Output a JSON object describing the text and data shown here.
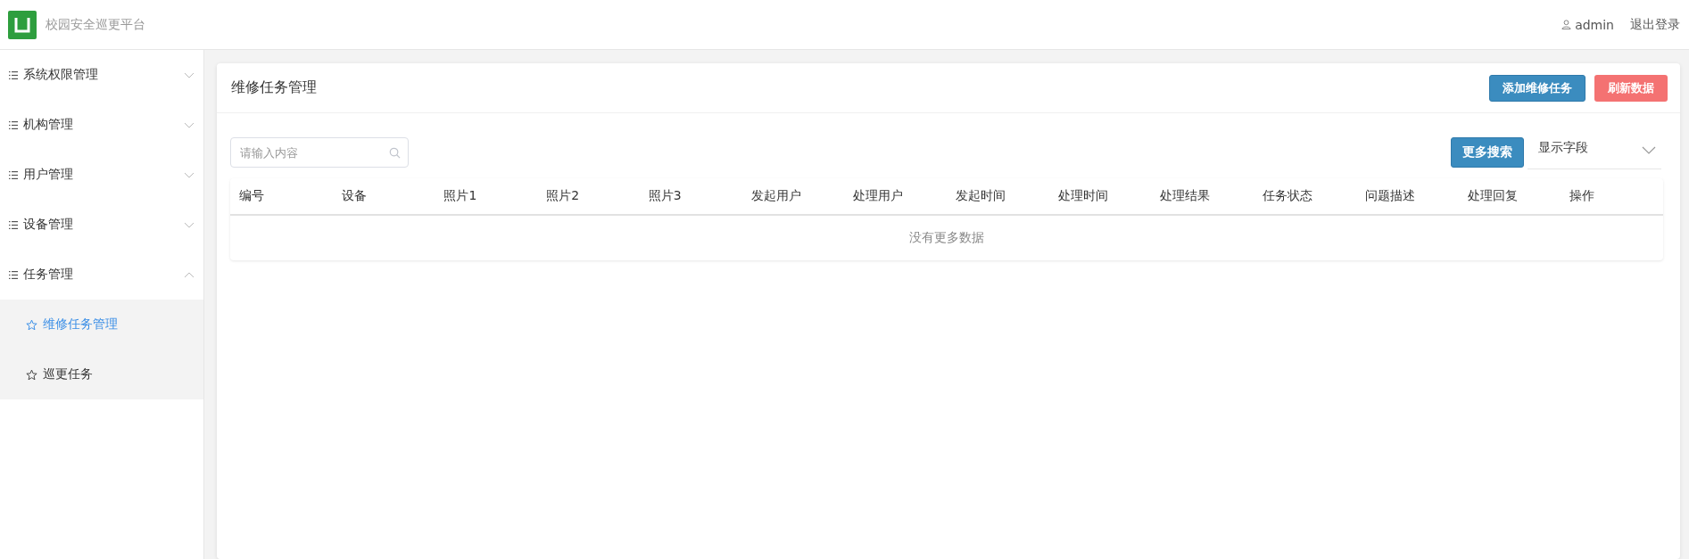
{
  "header": {
    "title": "校园安全巡更平台",
    "user": "admin",
    "logout": "退出登录"
  },
  "sidebar": {
    "items": [
      {
        "label": "系统权限管理",
        "expanded": false
      },
      {
        "label": "机构管理",
        "expanded": false
      },
      {
        "label": "用户管理",
        "expanded": false
      },
      {
        "label": "设备管理",
        "expanded": false
      },
      {
        "label": "任务管理",
        "expanded": true,
        "children": [
          {
            "label": "维修任务管理",
            "selected": true
          },
          {
            "label": "巡更任务",
            "selected": false
          }
        ]
      }
    ]
  },
  "panel": {
    "title": "维修任务管理",
    "buttons": [
      {
        "label": "添加维修任务",
        "kind": "primary"
      },
      {
        "label": "刷新数据",
        "kind": "danger"
      }
    ],
    "search": {
      "placeholder": "请输入内容"
    },
    "more_search": "更多搜索",
    "field_select": "显示字段",
    "table": {
      "columns": [
        "编号",
        "设备",
        "照片1",
        "照片2",
        "照片3",
        "发起用户",
        "处理用户",
        "发起时间",
        "处理时间",
        "处理结果",
        "任务状态",
        "问题描述",
        "处理回复",
        "操作"
      ],
      "empty_text": "没有更多数据"
    }
  }
}
